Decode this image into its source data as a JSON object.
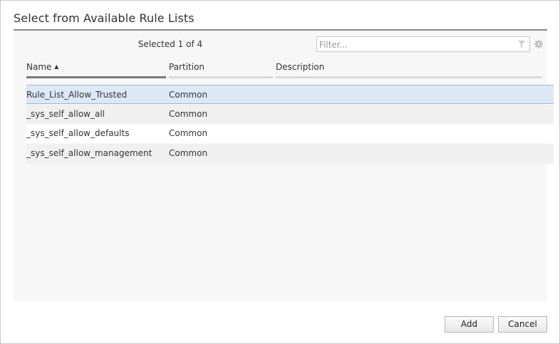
{
  "dialog": {
    "title": "Select from Available Rule Lists",
    "selected_text": "Selected 1 of 4",
    "filter": {
      "placeholder": "Filter...",
      "value": ""
    },
    "columns": [
      {
        "label": "Name",
        "sort": "ascending",
        "sort_glyph": "▲"
      },
      {
        "label": "Partition"
      },
      {
        "label": "Description"
      }
    ],
    "rows": [
      {
        "name": "Rule_List_Allow_Trusted",
        "partition": "Common",
        "description": "",
        "selected": true
      },
      {
        "name": "_sys_self_allow_all",
        "partition": "Common",
        "description": "",
        "selected": false
      },
      {
        "name": "_sys_self_allow_defaults",
        "partition": "Common",
        "description": "",
        "selected": false
      },
      {
        "name": "_sys_self_allow_management",
        "partition": "Common",
        "description": "",
        "selected": false
      }
    ],
    "buttons": {
      "add": "Add",
      "cancel": "Cancel"
    },
    "icons": {
      "filter": "filter-funnel-icon",
      "settings": "gear-icon"
    },
    "colors": {
      "selected_row": "#dde8f5",
      "selected_border": "#9ab5d8"
    }
  }
}
